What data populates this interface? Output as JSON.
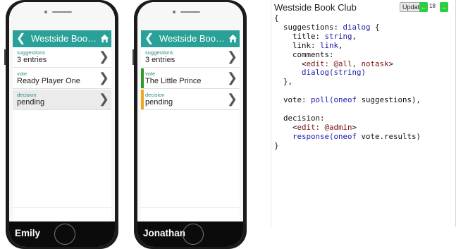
{
  "app": {
    "title": "Westside Book Club"
  },
  "phones": [
    {
      "user": "Emily",
      "rows": [
        {
          "label": "suggestions",
          "value": "3 entries"
        },
        {
          "label": "vote",
          "value": "Ready Player One"
        },
        {
          "label": "decision",
          "value": "pending"
        }
      ]
    },
    {
      "user": "Jonathan",
      "rows": [
        {
          "label": "suggestions",
          "value": "3 entries"
        },
        {
          "label": "vote",
          "value": "The Little Prince"
        },
        {
          "label": "decision",
          "value": "pending"
        }
      ]
    }
  ],
  "panel": {
    "title": "Westside Book Club",
    "update_label": "Update",
    "prev_label": "←",
    "next_label": "→",
    "page": "18"
  },
  "code": {
    "l1": "{",
    "l2a": "  suggestions: ",
    "l2b": "dialog",
    "l2c": " {",
    "l3a": "    title: ",
    "l3b": "string",
    "l3c": ",",
    "l4a": "    link: ",
    "l4b": "link",
    "l4c": ",",
    "l5": "    comments:",
    "l6a": "      <",
    "l6b": "edit: @all, notask",
    "l6c": ">",
    "l7a": "      ",
    "l7b": "dialog(string)",
    "l8": "  },",
    "l9": "",
    "l10a": "  vote: ",
    "l10b": "poll(oneof",
    "l10c": " suggestions),",
    "l11": "",
    "l12": "  decision:",
    "l13a": "    <",
    "l13b": "edit: @admin",
    "l13c": ">",
    "l14a": "    ",
    "l14b": "response(oneof",
    "l14c": " vote.results)",
    "l15": "}"
  },
  "colors": {
    "header_teal": "#2aa198",
    "vote_indicator": "#2e9a2e",
    "decision_indicator": "#f2a51f",
    "nav_green": "#2ecc40"
  },
  "icons": {
    "back": "chevron-left",
    "home": "home",
    "row": "chevron-right"
  }
}
